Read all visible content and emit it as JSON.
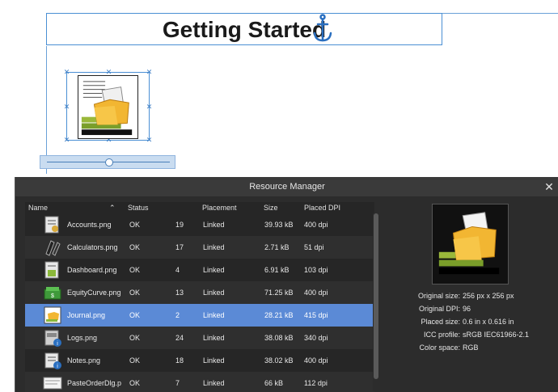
{
  "document": {
    "title": "Getting Started"
  },
  "resource_manager": {
    "title": "Resource Manager",
    "close_icon": "close-icon",
    "columns": {
      "name": "Name",
      "status": "Status",
      "placement": "Placement",
      "size": "Size",
      "dpi": "Placed DPI"
    },
    "rows": [
      {
        "name": "Accounts.png",
        "status": "OK",
        "count": "19",
        "placement": "Linked",
        "size": "39.93 kB",
        "dpi": "400 dpi",
        "icon": "accounts-icon"
      },
      {
        "name": "Calculators.png",
        "status": "OK",
        "count": "17",
        "placement": "Linked",
        "size": "2.71 kB",
        "dpi": "51 dpi",
        "icon": "calculators-icon"
      },
      {
        "name": "Dashboard.png",
        "status": "OK",
        "count": "4",
        "placement": "Linked",
        "size": "6.91 kB",
        "dpi": "103 dpi",
        "icon": "dashboard-icon"
      },
      {
        "name": "EquityCurve.png",
        "status": "OK",
        "count": "13",
        "placement": "Linked",
        "size": "71.25 kB",
        "dpi": "400 dpi",
        "icon": "equity-curve-icon"
      },
      {
        "name": "Journal.png",
        "status": "OK",
        "count": "2",
        "placement": "Linked",
        "size": "28.21 kB",
        "dpi": "415 dpi",
        "icon": "journal-icon",
        "selected": true
      },
      {
        "name": "Logs.png",
        "status": "OK",
        "count": "24",
        "placement": "Linked",
        "size": "38.08 kB",
        "dpi": "340 dpi",
        "icon": "logs-icon"
      },
      {
        "name": "Notes.png",
        "status": "OK",
        "count": "18",
        "placement": "Linked",
        "size": "38.02 kB",
        "dpi": "400 dpi",
        "icon": "notes-icon"
      },
      {
        "name": "PasteOrderDlg.p",
        "status": "OK",
        "count": "7",
        "placement": "Linked",
        "size": "66 kB",
        "dpi": "112 dpi",
        "icon": "paste-order-icon"
      }
    ],
    "info": {
      "original_size_label": "Original size:",
      "original_size": "256 px x 256 px",
      "original_dpi_label": "Original DPI:",
      "original_dpi": "96",
      "placed_size_label": "Placed size:",
      "placed_size": "0.6 in x 0.616 in",
      "icc_label": "ICC profile:",
      "icc": "sRGB IEC61966-2.1",
      "color_space_label": "Color space:",
      "color_space": "RGB"
    }
  },
  "colors": {
    "selection": "#5b8ad6",
    "guide": "#4a8fd4",
    "panel": "#2c2c2c"
  }
}
